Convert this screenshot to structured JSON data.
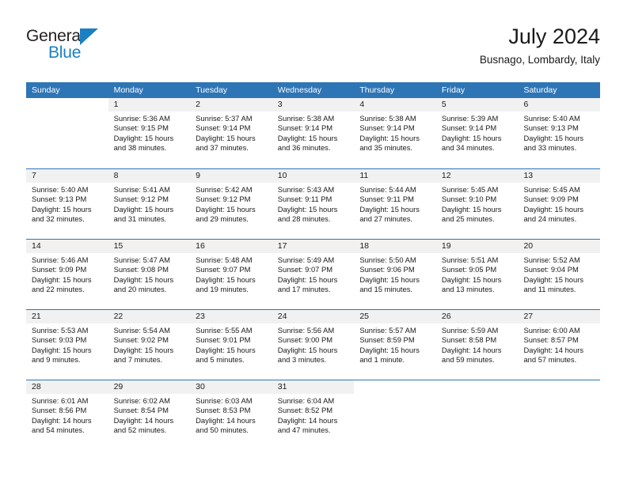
{
  "brand": {
    "name_part1": "General",
    "name_part2": "Blue",
    "triangle_color": "#1b7fc4",
    "text_color": "#231f20"
  },
  "header": {
    "title": "July 2024",
    "subtitle": "Busnago, Lombardy, Italy"
  },
  "theme": {
    "header_blue": "#2e75b6",
    "daynum_bg": "#f1f1f1",
    "page_bg": "#ffffff",
    "text": "#1a1a1a"
  },
  "weekdays": [
    "Sunday",
    "Monday",
    "Tuesday",
    "Wednesday",
    "Thursday",
    "Friday",
    "Saturday"
  ],
  "weeks": [
    [
      {
        "day": "",
        "sunrise": "",
        "sunset": "",
        "daylight_l1": "",
        "daylight_l2": "",
        "blank": true
      },
      {
        "day": "1",
        "sunrise": "Sunrise: 5:36 AM",
        "sunset": "Sunset: 9:15 PM",
        "daylight_l1": "Daylight: 15 hours",
        "daylight_l2": "and 38 minutes."
      },
      {
        "day": "2",
        "sunrise": "Sunrise: 5:37 AM",
        "sunset": "Sunset: 9:14 PM",
        "daylight_l1": "Daylight: 15 hours",
        "daylight_l2": "and 37 minutes."
      },
      {
        "day": "3",
        "sunrise": "Sunrise: 5:38 AM",
        "sunset": "Sunset: 9:14 PM",
        "daylight_l1": "Daylight: 15 hours",
        "daylight_l2": "and 36 minutes."
      },
      {
        "day": "4",
        "sunrise": "Sunrise: 5:38 AM",
        "sunset": "Sunset: 9:14 PM",
        "daylight_l1": "Daylight: 15 hours",
        "daylight_l2": "and 35 minutes."
      },
      {
        "day": "5",
        "sunrise": "Sunrise: 5:39 AM",
        "sunset": "Sunset: 9:14 PM",
        "daylight_l1": "Daylight: 15 hours",
        "daylight_l2": "and 34 minutes."
      },
      {
        "day": "6",
        "sunrise": "Sunrise: 5:40 AM",
        "sunset": "Sunset: 9:13 PM",
        "daylight_l1": "Daylight: 15 hours",
        "daylight_l2": "and 33 minutes."
      }
    ],
    [
      {
        "day": "7",
        "sunrise": "Sunrise: 5:40 AM",
        "sunset": "Sunset: 9:13 PM",
        "daylight_l1": "Daylight: 15 hours",
        "daylight_l2": "and 32 minutes."
      },
      {
        "day": "8",
        "sunrise": "Sunrise: 5:41 AM",
        "sunset": "Sunset: 9:12 PM",
        "daylight_l1": "Daylight: 15 hours",
        "daylight_l2": "and 31 minutes."
      },
      {
        "day": "9",
        "sunrise": "Sunrise: 5:42 AM",
        "sunset": "Sunset: 9:12 PM",
        "daylight_l1": "Daylight: 15 hours",
        "daylight_l2": "and 29 minutes."
      },
      {
        "day": "10",
        "sunrise": "Sunrise: 5:43 AM",
        "sunset": "Sunset: 9:11 PM",
        "daylight_l1": "Daylight: 15 hours",
        "daylight_l2": "and 28 minutes."
      },
      {
        "day": "11",
        "sunrise": "Sunrise: 5:44 AM",
        "sunset": "Sunset: 9:11 PM",
        "daylight_l1": "Daylight: 15 hours",
        "daylight_l2": "and 27 minutes."
      },
      {
        "day": "12",
        "sunrise": "Sunrise: 5:45 AM",
        "sunset": "Sunset: 9:10 PM",
        "daylight_l1": "Daylight: 15 hours",
        "daylight_l2": "and 25 minutes."
      },
      {
        "day": "13",
        "sunrise": "Sunrise: 5:45 AM",
        "sunset": "Sunset: 9:09 PM",
        "daylight_l1": "Daylight: 15 hours",
        "daylight_l2": "and 24 minutes."
      }
    ],
    [
      {
        "day": "14",
        "sunrise": "Sunrise: 5:46 AM",
        "sunset": "Sunset: 9:09 PM",
        "daylight_l1": "Daylight: 15 hours",
        "daylight_l2": "and 22 minutes."
      },
      {
        "day": "15",
        "sunrise": "Sunrise: 5:47 AM",
        "sunset": "Sunset: 9:08 PM",
        "daylight_l1": "Daylight: 15 hours",
        "daylight_l2": "and 20 minutes."
      },
      {
        "day": "16",
        "sunrise": "Sunrise: 5:48 AM",
        "sunset": "Sunset: 9:07 PM",
        "daylight_l1": "Daylight: 15 hours",
        "daylight_l2": "and 19 minutes."
      },
      {
        "day": "17",
        "sunrise": "Sunrise: 5:49 AM",
        "sunset": "Sunset: 9:07 PM",
        "daylight_l1": "Daylight: 15 hours",
        "daylight_l2": "and 17 minutes."
      },
      {
        "day": "18",
        "sunrise": "Sunrise: 5:50 AM",
        "sunset": "Sunset: 9:06 PM",
        "daylight_l1": "Daylight: 15 hours",
        "daylight_l2": "and 15 minutes."
      },
      {
        "day": "19",
        "sunrise": "Sunrise: 5:51 AM",
        "sunset": "Sunset: 9:05 PM",
        "daylight_l1": "Daylight: 15 hours",
        "daylight_l2": "and 13 minutes."
      },
      {
        "day": "20",
        "sunrise": "Sunrise: 5:52 AM",
        "sunset": "Sunset: 9:04 PM",
        "daylight_l1": "Daylight: 15 hours",
        "daylight_l2": "and 11 minutes."
      }
    ],
    [
      {
        "day": "21",
        "sunrise": "Sunrise: 5:53 AM",
        "sunset": "Sunset: 9:03 PM",
        "daylight_l1": "Daylight: 15 hours",
        "daylight_l2": "and 9 minutes."
      },
      {
        "day": "22",
        "sunrise": "Sunrise: 5:54 AM",
        "sunset": "Sunset: 9:02 PM",
        "daylight_l1": "Daylight: 15 hours",
        "daylight_l2": "and 7 minutes."
      },
      {
        "day": "23",
        "sunrise": "Sunrise: 5:55 AM",
        "sunset": "Sunset: 9:01 PM",
        "daylight_l1": "Daylight: 15 hours",
        "daylight_l2": "and 5 minutes."
      },
      {
        "day": "24",
        "sunrise": "Sunrise: 5:56 AM",
        "sunset": "Sunset: 9:00 PM",
        "daylight_l1": "Daylight: 15 hours",
        "daylight_l2": "and 3 minutes."
      },
      {
        "day": "25",
        "sunrise": "Sunrise: 5:57 AM",
        "sunset": "Sunset: 8:59 PM",
        "daylight_l1": "Daylight: 15 hours",
        "daylight_l2": "and 1 minute."
      },
      {
        "day": "26",
        "sunrise": "Sunrise: 5:59 AM",
        "sunset": "Sunset: 8:58 PM",
        "daylight_l1": "Daylight: 14 hours",
        "daylight_l2": "and 59 minutes."
      },
      {
        "day": "27",
        "sunrise": "Sunrise: 6:00 AM",
        "sunset": "Sunset: 8:57 PM",
        "daylight_l1": "Daylight: 14 hours",
        "daylight_l2": "and 57 minutes."
      }
    ],
    [
      {
        "day": "28",
        "sunrise": "Sunrise: 6:01 AM",
        "sunset": "Sunset: 8:56 PM",
        "daylight_l1": "Daylight: 14 hours",
        "daylight_l2": "and 54 minutes."
      },
      {
        "day": "29",
        "sunrise": "Sunrise: 6:02 AM",
        "sunset": "Sunset: 8:54 PM",
        "daylight_l1": "Daylight: 14 hours",
        "daylight_l2": "and 52 minutes."
      },
      {
        "day": "30",
        "sunrise": "Sunrise: 6:03 AM",
        "sunset": "Sunset: 8:53 PM",
        "daylight_l1": "Daylight: 14 hours",
        "daylight_l2": "and 50 minutes."
      },
      {
        "day": "31",
        "sunrise": "Sunrise: 6:04 AM",
        "sunset": "Sunset: 8:52 PM",
        "daylight_l1": "Daylight: 14 hours",
        "daylight_l2": "and 47 minutes."
      },
      {
        "day": "",
        "sunrise": "",
        "sunset": "",
        "daylight_l1": "",
        "daylight_l2": "",
        "blank": true
      },
      {
        "day": "",
        "sunrise": "",
        "sunset": "",
        "daylight_l1": "",
        "daylight_l2": "",
        "blank": true
      },
      {
        "day": "",
        "sunrise": "",
        "sunset": "",
        "daylight_l1": "",
        "daylight_l2": "",
        "blank": true
      }
    ]
  ]
}
